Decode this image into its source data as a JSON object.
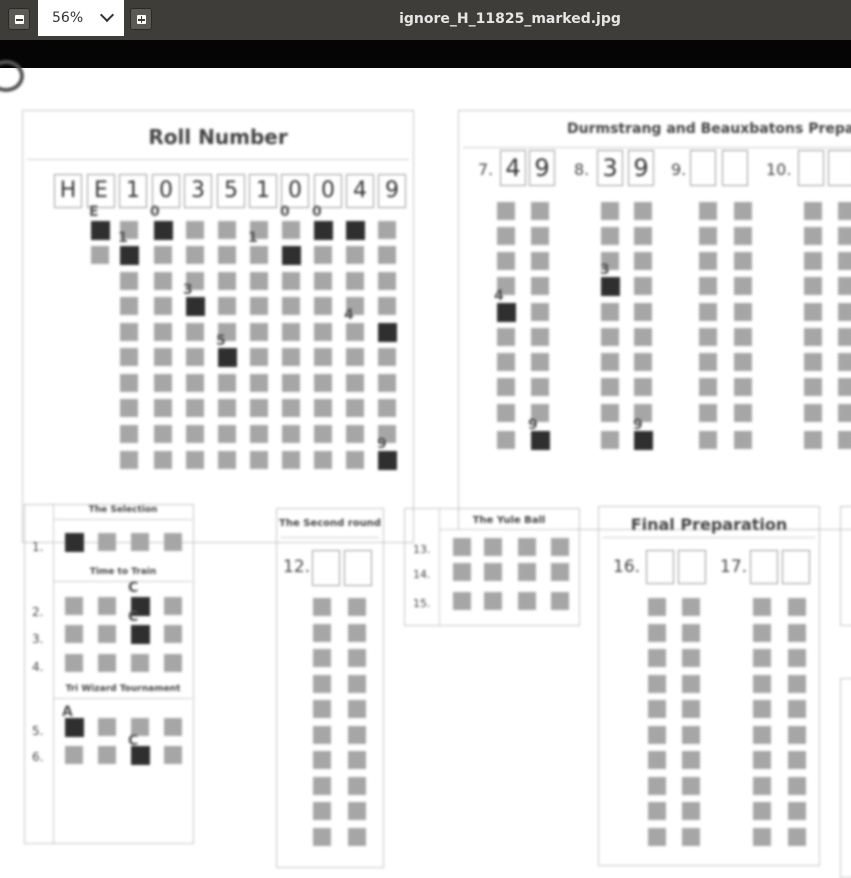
{
  "toolbar": {
    "zoom_out_label": "−",
    "zoom_value": "56%",
    "zoom_in_label": "+",
    "window_title": "ignore_H_11825_marked.jpg"
  },
  "icons": {
    "zoom_out": "minus-icon",
    "zoom_dropdown": "chevron-down-icon",
    "zoom_in": "plus-icon"
  },
  "colors": {
    "toolbar_bg": "#3f3d39",
    "filled_bubble": "#2f2f2f",
    "empty_bubble": "#a6a6a6"
  },
  "document": {
    "roll_number": {
      "title": "Roll Number",
      "handwritten": [
        "H",
        "E",
        "1",
        "0",
        "3",
        "5",
        "1",
        "0",
        "0",
        "4",
        "9"
      ],
      "marks": [
        "E",
        "0",
        "1",
        "3",
        "5",
        "1",
        "0",
        "0",
        "4",
        "9"
      ]
    },
    "durmstrang": {
      "title": "Durmstrang and Beauxbatons Prepar",
      "questions": [
        "7.",
        "8.",
        "9.",
        "10."
      ],
      "q7_digits": [
        "4",
        "9"
      ],
      "q8_digits": [
        "3",
        "9"
      ],
      "marks": [
        "4",
        "9",
        "3",
        "9"
      ]
    },
    "left_panel": {
      "sections": [
        "The Selection",
        "Time to Train",
        "Tri Wizard Tournament"
      ],
      "numbers": [
        "1.",
        "2.",
        "3.",
        "4.",
        "5.",
        "6."
      ],
      "marks": [
        "C",
        "C",
        "A",
        "C"
      ]
    },
    "second_round": {
      "title": "The Second round",
      "question": "12."
    },
    "yule_ball": {
      "title": "The Yule Ball",
      "questions": [
        "13.",
        "14.",
        "15."
      ]
    },
    "final_prep": {
      "title": "Final Preparation",
      "questions": [
        "16.",
        "17."
      ]
    }
  }
}
